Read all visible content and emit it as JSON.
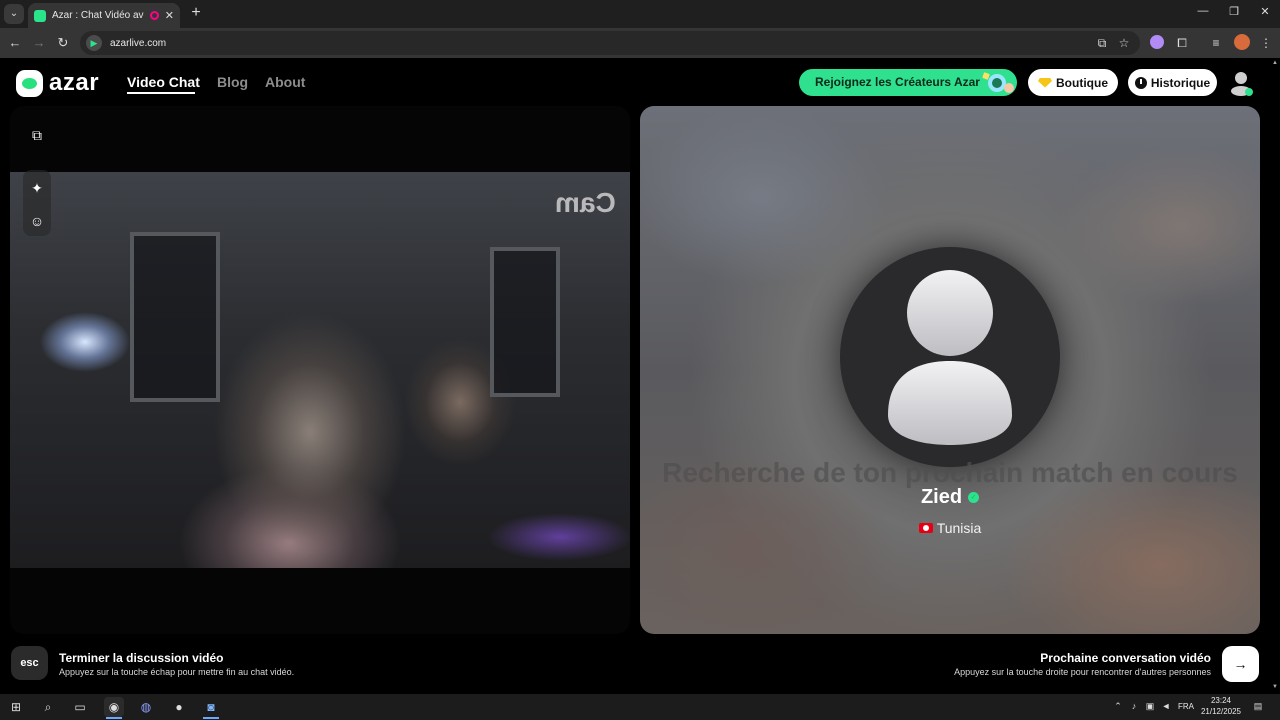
{
  "browser": {
    "tab_title": "Azar : Chat Vidéo avec de n",
    "url": "azarlive.com",
    "new_tab_symbol": "+",
    "minimize_symbol": "—",
    "restore_symbol": "❐",
    "close_symbol": "✕"
  },
  "site": {
    "logo_text": "azar",
    "nav": [
      {
        "label": "Video Chat",
        "active": true
      },
      {
        "label": "Blog",
        "active": false
      },
      {
        "label": "About",
        "active": false
      }
    ],
    "creators_button": "Rejoignez les Créateurs Azar",
    "boutique_button": "Boutique",
    "historique_button": "Historique"
  },
  "local_video": {
    "watermark": "Cam"
  },
  "match": {
    "searching_text": "Recherche de ton prochain match en cours",
    "name": "Zied",
    "country": "Tunisia"
  },
  "footer": {
    "esc_key": "esc",
    "end_title": "Terminer la discussion vidéo",
    "end_sub": "Appuyez sur la touche échap pour mettre fin au chat vidéo.",
    "next_title": "Prochaine conversation vidéo",
    "next_sub": "Appuyez sur la touche droite pour rencontrer d'autres personnes",
    "next_key_symbol": "→"
  },
  "taskbar": {
    "language": "FRA",
    "time": "23:24",
    "date": "21/12/2025"
  },
  "colors": {
    "accent_green": "#2fe08f",
    "background": "#000000"
  }
}
